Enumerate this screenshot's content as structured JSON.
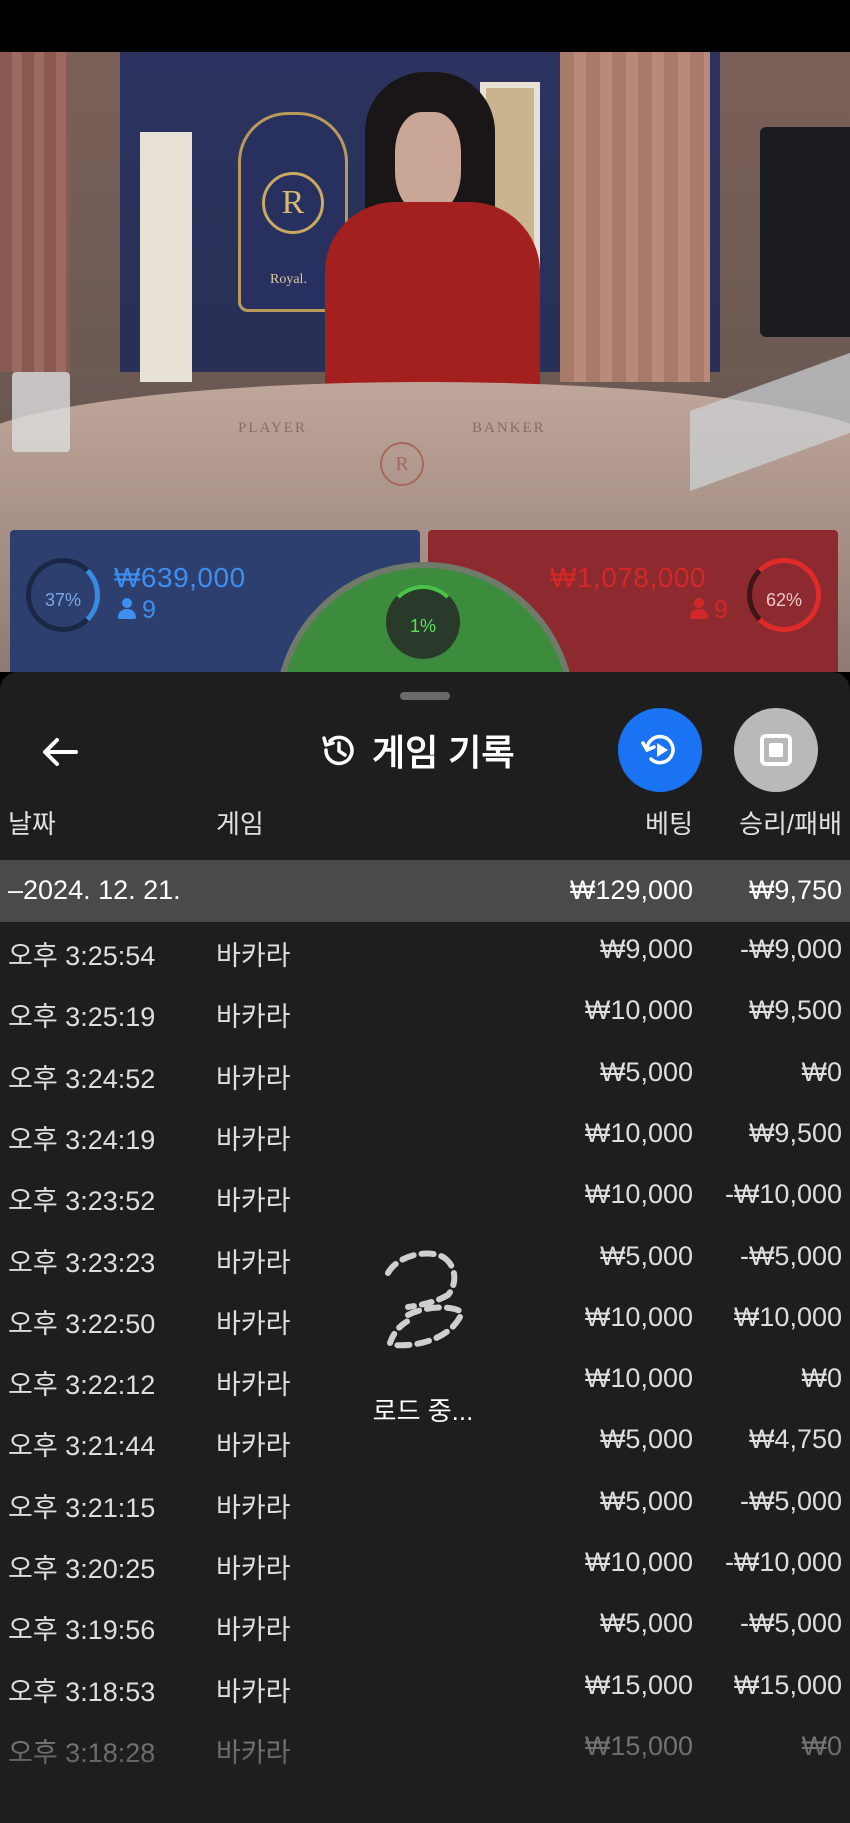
{
  "video": {
    "crest_letter": "R",
    "crest_text": "Royal.",
    "table_player_label": "PLAYER",
    "table_banker_label": "BANKER",
    "table_logo_letter": "R"
  },
  "betting": {
    "player": {
      "percent": "37%",
      "amount": "₩639,000",
      "players": "9",
      "color": "#3e8ff0"
    },
    "tie": {
      "percent": "1%",
      "color": "#5ee05e"
    },
    "banker": {
      "percent": "62%",
      "amount": "₩1,078,000",
      "players": "9",
      "color": "#d42727"
    }
  },
  "history": {
    "title": "게임 기록",
    "icons": {
      "back": "arrow-left-icon",
      "title": "history-icon",
      "replay": "replay-icon",
      "stop": "stop-icon"
    },
    "accent_color": "#1a73f2",
    "columns": {
      "date": "날짜",
      "game": "게임",
      "bet": "베팅",
      "win_loss": "승리/패배"
    },
    "group": {
      "date": "–2024. 12. 21.",
      "bet_total": "₩129,000",
      "win_total": "₩9,750"
    },
    "rows": [
      {
        "time": "오후 3:25:54",
        "game": "바카라",
        "bet": "₩9,000",
        "result": "-₩9,000"
      },
      {
        "time": "오후 3:25:19",
        "game": "바카라",
        "bet": "₩10,000",
        "result": "₩9,500"
      },
      {
        "time": "오후 3:24:52",
        "game": "바카라",
        "bet": "₩5,000",
        "result": "₩0"
      },
      {
        "time": "오후 3:24:19",
        "game": "바카라",
        "bet": "₩10,000",
        "result": "₩9,500"
      },
      {
        "time": "오후 3:23:52",
        "game": "바카라",
        "bet": "₩10,000",
        "result": "-₩10,000"
      },
      {
        "time": "오후 3:23:23",
        "game": "바카라",
        "bet": "₩5,000",
        "result": "-₩5,000"
      },
      {
        "time": "오후 3:22:50",
        "game": "바카라",
        "bet": "₩10,000",
        "result": "₩10,000"
      },
      {
        "time": "오후 3:22:12",
        "game": "바카라",
        "bet": "₩10,000",
        "result": "₩0"
      },
      {
        "time": "오후 3:21:44",
        "game": "바카라",
        "bet": "₩5,000",
        "result": "₩4,750"
      },
      {
        "time": "오후 3:21:15",
        "game": "바카라",
        "bet": "₩5,000",
        "result": "-₩5,000"
      },
      {
        "time": "오후 3:20:25",
        "game": "바카라",
        "bet": "₩10,000",
        "result": "-₩10,000"
      },
      {
        "time": "오후 3:19:56",
        "game": "바카라",
        "bet": "₩5,000",
        "result": "-₩5,000"
      },
      {
        "time": "오후 3:18:53",
        "game": "바카라",
        "bet": "₩15,000",
        "result": "₩15,000"
      },
      {
        "time": "오후 3:18:28",
        "game": "바카라",
        "bet": "₩15,000",
        "result": "₩0"
      }
    ],
    "loading_text": "로드 중..."
  }
}
